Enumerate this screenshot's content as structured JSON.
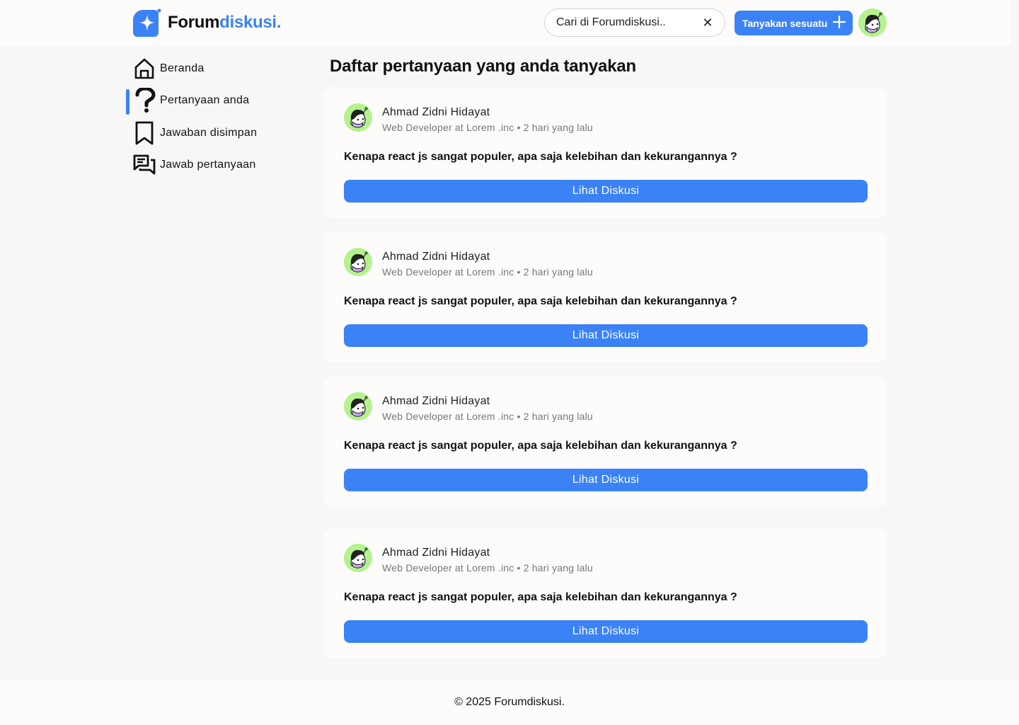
{
  "header": {
    "logo_part1": "Forum",
    "logo_part2": "diskusi.",
    "search_placeholder": "Cari di Forumdiskusi..",
    "clear_glyph": "✕",
    "ask_label": "Tanyakan sesuatu",
    "ask_icon": "plus-icon"
  },
  "sidebar": {
    "items": [
      {
        "label": "Beranda",
        "icon": "home-icon",
        "active": false
      },
      {
        "label": "Pertanyaan anda",
        "icon": "question-icon",
        "active": true
      },
      {
        "label": "Jawaban disimpan",
        "icon": "bookmark-icon",
        "active": false
      },
      {
        "label": "Jawab pertanyaan",
        "icon": "chat-icon",
        "active": false
      }
    ]
  },
  "main": {
    "title": "Daftar pertanyaan yang anda tanyakan",
    "cards": [
      {
        "author": "Ahmad Zidni Hidayat",
        "subtitle": "Web Developer at Lorem .inc • 2 hari yang lalu",
        "question": "Kenapa react js sangat populer, apa saja kelebihan dan kekurangannya ?",
        "button": "Lihat Diskusi"
      },
      {
        "author": "Ahmad Zidni Hidayat",
        "subtitle": "Web Developer at Lorem .inc • 2 hari yang lalu",
        "question": "Kenapa react js sangat populer, apa saja kelebihan dan kekurangannya ?",
        "button": "Lihat Diskusi"
      },
      {
        "author": "Ahmad Zidni Hidayat",
        "subtitle": "Web Developer at Lorem .inc • 2 hari yang lalu",
        "question": "Kenapa react js sangat populer, apa saja kelebihan dan kekurangannya ?",
        "button": "Lihat Diskusi"
      },
      {
        "author": "Ahmad Zidni Hidayat",
        "subtitle": "Web Developer at Lorem .inc • 2 hari yang lalu",
        "question": "Kenapa react js sangat populer, apa saja kelebihan dan kekurangannya ?",
        "button": "Lihat Diskusi"
      }
    ]
  },
  "footer": {
    "text": "© 2025 Forumdiskusi."
  },
  "colors": {
    "accent": "#3b82f6",
    "avatar_bg": "#b4f28e",
    "card_bg": "#fdfcfb",
    "page_bg": "#f7f7f8"
  }
}
